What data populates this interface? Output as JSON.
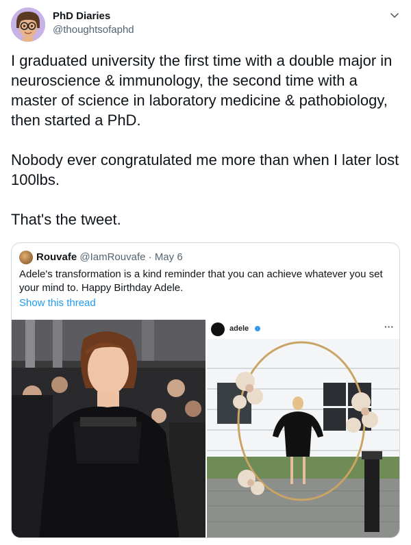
{
  "author": {
    "name": "PhD Diaries",
    "handle": "@thoughtsofaphd"
  },
  "tweet": {
    "paragraphs": [
      "I graduated university the first time with a double major in neuroscience & immunology, the second time with a master of science in laboratory medicine & pathobiology, then started a PhD.",
      "Nobody ever congratulated me more than when I later lost 100lbs.",
      "That's the tweet."
    ]
  },
  "quote": {
    "name": "Rouvafe",
    "handle": "@IamRouvafe",
    "separator": "·",
    "date": "May 6",
    "text": "Adele's transformation is a kind reminder that you can achieve whatever you set your mind to. Happy Birthday Adele.",
    "link": "Show this thread",
    "media_right": {
      "account": "adele",
      "more": "···"
    }
  },
  "colors": {
    "link": "#1d9bf0",
    "secondary_text": "#536471",
    "border": "#cfd9de",
    "verified": "#3897f0"
  },
  "icons": {
    "caret": "chevron-down-icon",
    "verified": "verified-badge-icon"
  }
}
